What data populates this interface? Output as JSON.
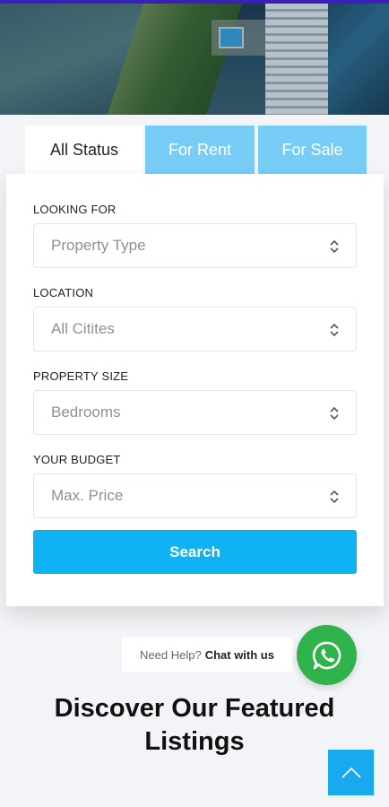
{
  "tabs": [
    {
      "label": "All Status"
    },
    {
      "label": "For Rent"
    },
    {
      "label": "For Sale"
    }
  ],
  "form": {
    "fields": [
      {
        "label": "LOOKING FOR",
        "placeholder": "Property Type"
      },
      {
        "label": "LOCATION",
        "placeholder": "All Citites"
      },
      {
        "label": "PROPERTY SIZE",
        "placeholder": "Bedrooms"
      },
      {
        "label": "YOUR BUDGET",
        "placeholder": "Max. Price"
      }
    ],
    "search_label": "Search"
  },
  "help": {
    "prompt": "Need Help?",
    "link": "Chat with us"
  },
  "featured": {
    "heading_line1": "Discover Our Featured",
    "heading_line2": "Listings"
  },
  "colors": {
    "accent": "#0fb2f2",
    "tab_inactive": "#78cdf7",
    "whatsapp": "#2fb34a",
    "topbar": "#3a1fb8"
  }
}
